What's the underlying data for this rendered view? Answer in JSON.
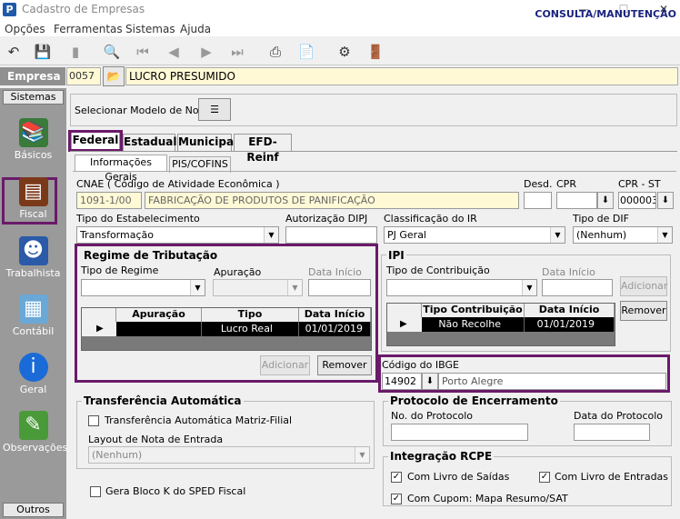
{
  "window": {
    "title": "Cadastro de Empresas"
  },
  "menu": [
    "Opções",
    "Ferramentas",
    "Sistemas",
    "Ajuda"
  ],
  "toolbar": {
    "mode": "CONSULTA/MANUTENÇÃO"
  },
  "empresa": {
    "label": "Empresa",
    "code": "0057",
    "name": "LUCRO PRESUMIDO"
  },
  "sidebar": {
    "header": "Sistemas",
    "footer": "Outros",
    "items": [
      {
        "label": "Básicos",
        "icon": "books-icon"
      },
      {
        "label": "Fiscal",
        "icon": "cash-register-icon"
      },
      {
        "label": "Trabalhista",
        "icon": "worker-icon"
      },
      {
        "label": "Contábil",
        "icon": "calculator-icon"
      },
      {
        "label": "Geral",
        "icon": "info-icon"
      },
      {
        "label": "Observações",
        "icon": "notepad-icon"
      }
    ]
  },
  "modelo_nota": {
    "label": "Selecionar Modelo de Nota"
  },
  "tabs": [
    "Federal",
    "Estadual",
    "Municipal",
    "EFD-Reinf"
  ],
  "subtabs": [
    "Informações Gerais",
    "PIS/COFINS"
  ],
  "cnae": {
    "label": "CNAE ( Código de  Atividade Econômica )",
    "code": "1091-1/00",
    "description": "FABRICAÇÃO DE PRODUTOS DE PANIFICAÇÃO"
  },
  "desd": {
    "label": "Desd.",
    "value": ""
  },
  "cpr": {
    "label": "CPR",
    "value": ""
  },
  "cpr_st": {
    "label": "CPR - ST",
    "value": "000003"
  },
  "tipo_estabelecimento": {
    "label": "Tipo do Estabelecimento",
    "value": "Transformação"
  },
  "autorizacao_dipj": {
    "label": "Autorização DIPJ",
    "value": ""
  },
  "classificacao_ir": {
    "label": "Classificação do IR",
    "value": "PJ Geral"
  },
  "tipo_dif": {
    "label": "Tipo de DIF",
    "value": "(Nenhum)"
  },
  "regime": {
    "title": "Regime de Tributação",
    "tipo_label": "Tipo de Regime",
    "apuracao_label": "Apuração",
    "data_inicio_label": "Data Início",
    "columns": [
      "Apuração",
      "Tipo",
      "Data Início"
    ],
    "rows": [
      {
        "apuracao": "",
        "tipo": "Lucro Real",
        "data_inicio": "01/01/2019"
      }
    ],
    "btn_adicionar": "Adicionar",
    "btn_remover": "Remover"
  },
  "ipi": {
    "title": "IPI",
    "tipo_label": "Tipo de Contribuição",
    "data_inicio_label": "Data Início",
    "columns": [
      "Tipo Contribuição",
      "Data Início"
    ],
    "rows": [
      {
        "tipo": "Não Recolhe",
        "data_inicio": "01/01/2019"
      }
    ],
    "btn_adicionar": "Adicionar",
    "btn_remover": "Remover"
  },
  "ibge": {
    "label": "Código do IBGE",
    "code": "14902",
    "city": "Porto Alegre"
  },
  "transferencia": {
    "title": "Transferência Automática",
    "check_label": "Transferência Automática Matriz-Filial",
    "checked": false,
    "layout_label": "Layout de Nota de Entrada",
    "layout_value": "(Nenhum)"
  },
  "bloco_k": {
    "label": "Gera Bloco K do SPED Fiscal",
    "checked": false
  },
  "protocolo": {
    "title": "Protocolo de Encerramento",
    "numero_label": "No. do Protocolo",
    "data_label": "Data do Protocolo"
  },
  "rcpe": {
    "title": "Integração RCPE",
    "saidas": "Com Livro de Saídas",
    "entradas": "Com Livro de Entradas",
    "cupom": "Com Cupom: Mapa Resumo/SAT"
  }
}
